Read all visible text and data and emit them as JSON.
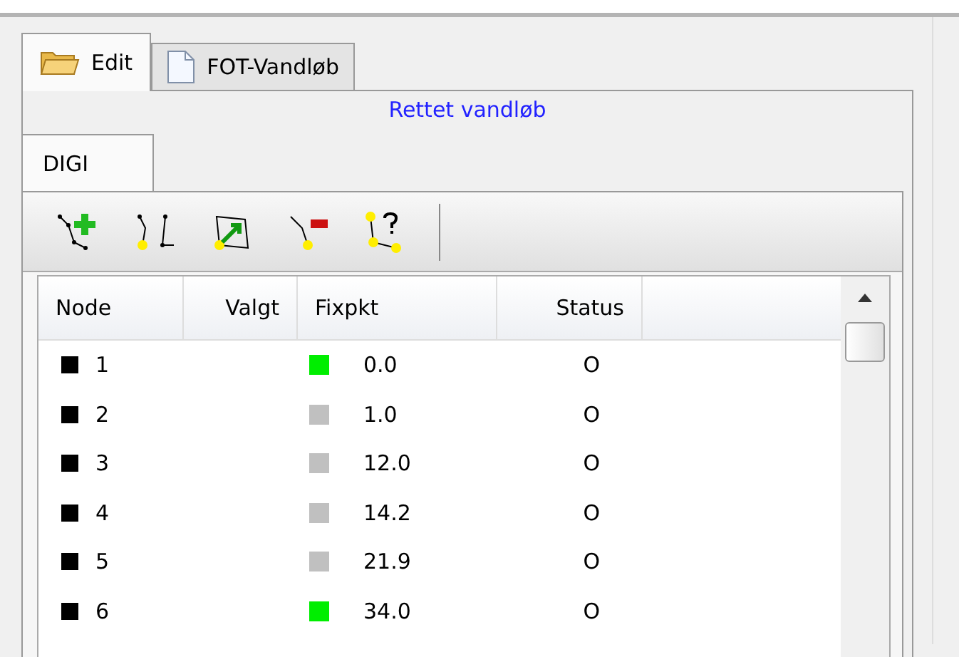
{
  "tabs": [
    {
      "label": "Edit",
      "selected": true
    },
    {
      "label": "FOT-Vandløb",
      "selected": false
    }
  ],
  "panel_title": "Rettet vandløb",
  "subtabs": [
    {
      "label": "DIGI",
      "selected": true
    }
  ],
  "table": {
    "columns": [
      "Node",
      "Valgt",
      "Fixpkt",
      "Status"
    ],
    "rows": [
      {
        "node": "1",
        "fixpkt": "0.0",
        "color": "#00ee00",
        "status": "O"
      },
      {
        "node": "2",
        "fixpkt": "1.0",
        "color": "#c0c0c0",
        "status": "O"
      },
      {
        "node": "3",
        "fixpkt": "12.0",
        "color": "#c0c0c0",
        "status": "O"
      },
      {
        "node": "4",
        "fixpkt": "14.2",
        "color": "#c0c0c0",
        "status": "O"
      },
      {
        "node": "5",
        "fixpkt": "21.9",
        "color": "#c0c0c0",
        "status": "O"
      },
      {
        "node": "6",
        "fixpkt": "34.0",
        "color": "#00ee00",
        "status": "O"
      }
    ]
  }
}
